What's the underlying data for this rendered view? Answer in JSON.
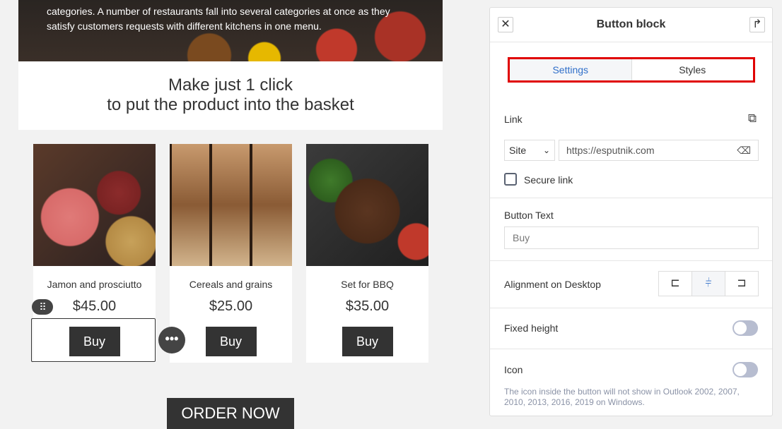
{
  "email": {
    "hero_text": "categories. A number of restaurants fall into several categories at once as they satisfy customers requests with different kitchens in one menu.",
    "headline_line1": "Make just 1 click",
    "headline_line2": "to put the product into the basket",
    "products": [
      {
        "name": "Jamon and prosciutto",
        "price": "$45.00",
        "button": "Buy"
      },
      {
        "name": "Cereals and grains",
        "price": "$25.00",
        "button": "Buy"
      },
      {
        "name": "Set for BBQ",
        "price": "$35.00",
        "button": "Buy"
      }
    ],
    "order_button": "ORDER NOW",
    "handle_glyph": "⠿",
    "more_glyph": "•••"
  },
  "panel": {
    "title": "Button block",
    "close_glyph": "✕",
    "collapse_glyph": "↱",
    "tabs": [
      "Settings",
      "Styles"
    ],
    "active_tab": "Settings",
    "link_label": "Link",
    "open_link_glyph": "⧉",
    "link_type": "Site",
    "url_value": "https://esputnik.com",
    "clear_glyph": "⌫",
    "secure_link_label": "Secure link",
    "secure_link_checked": false,
    "button_text_label": "Button Text",
    "button_text_placeholder": "Buy",
    "alignment_label": "Alignment on Desktop",
    "alignment_options": [
      "left",
      "center",
      "right"
    ],
    "alignment_selected": "center",
    "fixed_height_label": "Fixed height",
    "fixed_height_on": false,
    "icon_label": "Icon",
    "icon_on": false,
    "icon_note": "The icon inside the button will not show in Outlook 2002, 2007, 2010, 2013, 2016, 2019 on Windows."
  },
  "colors": {
    "accent": "#2f6fc9",
    "highlight_border": "#e00000",
    "button_dark": "#333333"
  }
}
